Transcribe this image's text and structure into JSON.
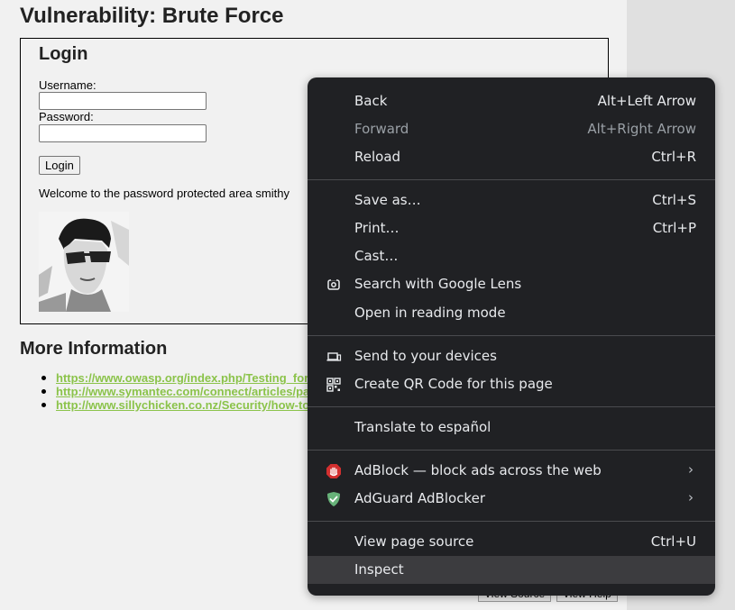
{
  "page": {
    "title": "Vulnerability: Brute Force",
    "login": {
      "heading": "Login",
      "username_label": "Username:",
      "password_label": "Password:",
      "username_value": "",
      "password_value": "",
      "button_label": "Login",
      "welcome_text": "Welcome to the password protected area smithy"
    },
    "more_info": {
      "heading": "More Information",
      "links": [
        "https://www.owasp.org/index.php/Testing_for_Brute_Force_(OWASP-AT-004)",
        "http://www.symantec.com/connect/articles/password-crackers-ensuring-security-your-password",
        "http://www.sillychicken.co.nz/Security/how-to-brute-force-http-forms-in-windows.html"
      ]
    },
    "bottom_buttons": [
      "View Source",
      "View Help"
    ]
  },
  "context_menu": {
    "groups": [
      [
        {
          "label": "Back",
          "shortcut": "Alt+Left Arrow",
          "disabled": false
        },
        {
          "label": "Forward",
          "shortcut": "Alt+Right Arrow",
          "disabled": true
        },
        {
          "label": "Reload",
          "shortcut": "Ctrl+R",
          "disabled": false
        }
      ],
      [
        {
          "label": "Save as…",
          "shortcut": "Ctrl+S"
        },
        {
          "label": "Print…",
          "shortcut": "Ctrl+P"
        },
        {
          "label": "Cast…",
          "shortcut": ""
        },
        {
          "label": "Search with Google Lens",
          "shortcut": "",
          "icon": "google-lens-icon"
        },
        {
          "label": "Open in reading mode",
          "shortcut": ""
        }
      ],
      [
        {
          "label": "Send to your devices",
          "shortcut": "",
          "icon": "send-to-devices-icon"
        },
        {
          "label": "Create QR Code for this page",
          "shortcut": "",
          "icon": "qr-code-icon"
        }
      ],
      [
        {
          "label": "Translate to español",
          "shortcut": ""
        }
      ],
      [
        {
          "label": "AdBlock — block ads across the web",
          "icon": "adblock-icon",
          "submenu": true
        },
        {
          "label": "AdGuard AdBlocker",
          "icon": "adguard-icon",
          "submenu": true
        }
      ],
      [
        {
          "label": "View page source",
          "shortcut": "Ctrl+U"
        },
        {
          "label": "Inspect",
          "shortcut": "",
          "hovered": true
        }
      ]
    ],
    "colors": {
      "background": "#202124",
      "text": "#e8eaed",
      "disabled_text": "#9aa0a6",
      "hover": "#3c3c3f",
      "adblock_red": "#d32f2f",
      "adguard_green": "#67b279"
    }
  }
}
